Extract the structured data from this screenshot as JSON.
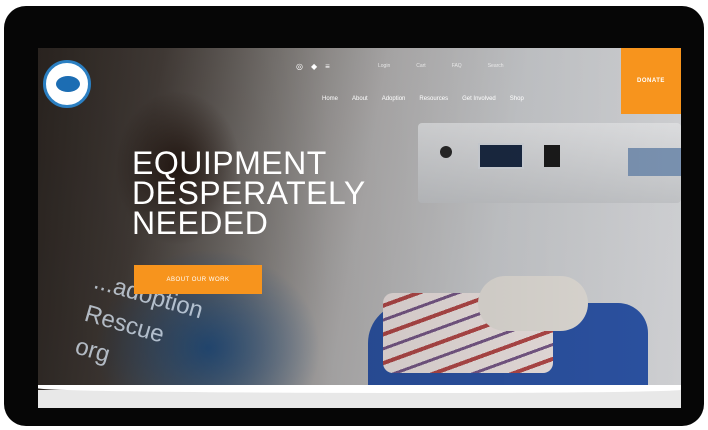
{
  "header": {
    "social_icons": [
      "instagram-icon",
      "twitter-icon",
      "facebook-icon"
    ],
    "social_glyphs": [
      "◎",
      "◆",
      "≡"
    ],
    "utility_links": [
      "Login",
      "Cart",
      "FAQ",
      "Search"
    ],
    "donate_label": "DONATE"
  },
  "nav": {
    "items": [
      "Home",
      "About",
      "Adoption",
      "Resources",
      "Get Involved",
      "Shop"
    ]
  },
  "hero": {
    "headline_lines": [
      "EQUIPMENT",
      "DESPERATELY",
      "NEEDED"
    ],
    "cta_label": "ABOUT OUR WORK",
    "shirt_lines": [
      "...adoption",
      "Rescue",
      "org"
    ]
  },
  "colors": {
    "accent": "#f7941d",
    "device_frame": "#060606",
    "logo_blue": "#2b7fc2"
  }
}
